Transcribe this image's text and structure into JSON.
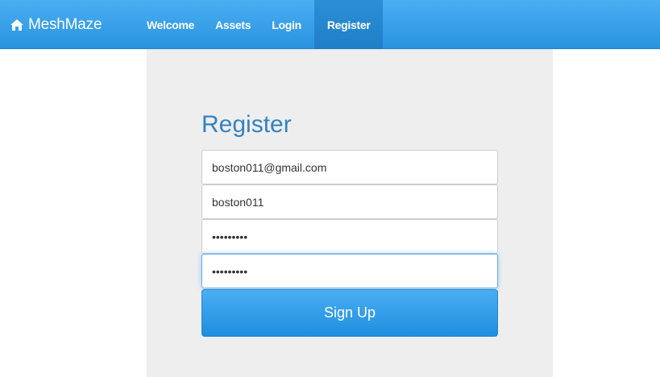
{
  "navbar": {
    "brand": "MeshMaze",
    "brand_icon": "home-icon",
    "links": [
      {
        "label": "Welcome"
      },
      {
        "label": "Assets"
      },
      {
        "label": "Login"
      },
      {
        "label": "Register",
        "active": true
      }
    ],
    "accent_color": "#3aa0ea"
  },
  "form": {
    "title": "Register",
    "email_value": "boston011@gmail.com",
    "username_value": "boston011",
    "password_value": "•••••••••",
    "confirm_password_value": "•••••••••",
    "submit_label": "Sign Up",
    "title_color": "#3582c1"
  }
}
